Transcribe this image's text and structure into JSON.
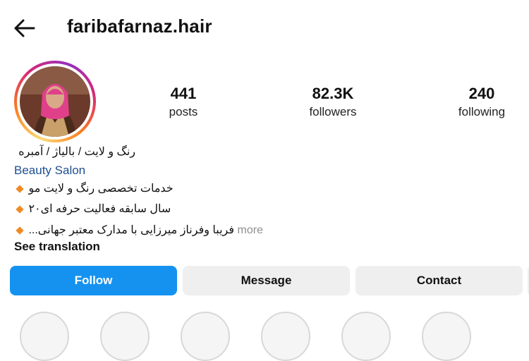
{
  "header": {
    "username": "faribafarnaz.hair"
  },
  "stats": [
    {
      "value": "441",
      "label": "posts"
    },
    {
      "value": "82.3K",
      "label": "followers"
    },
    {
      "value": "240",
      "label": "following"
    }
  ],
  "bio": {
    "name": "رنگ و لایت / بالیاژ / آمبره",
    "category": "Beauty Salon",
    "line1": "خدمات تخصصی رنگ و لایت مو",
    "line2": "سال سابقه فعالیت حرفه ای۲۰",
    "line3": "فریبا وفرناز میرزایی با مدارک معتبر جهانی...",
    "more": "more",
    "see_translation": "See translation"
  },
  "buttons": {
    "follow": "Follow",
    "message": "Message",
    "contact": "Contact"
  },
  "colors": {
    "follow_bg": "#1592f0",
    "category": "#1d4f91",
    "bullet": "#f08a24"
  },
  "icons": {
    "back": "arrow-left-icon",
    "bullet": "orange-diamond-icon"
  }
}
